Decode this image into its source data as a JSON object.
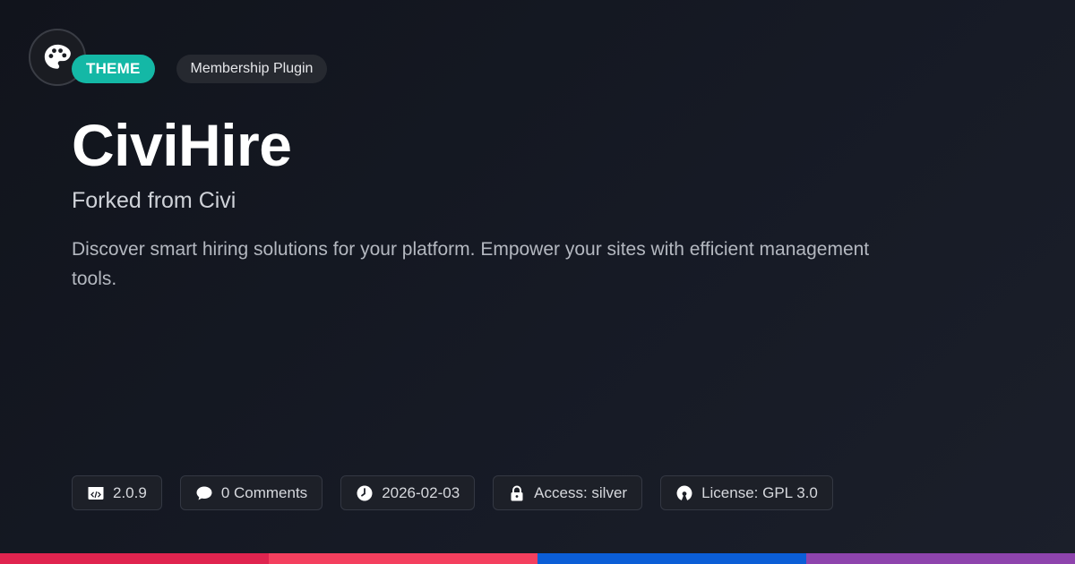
{
  "badges": {
    "type": "THEME",
    "category": "Membership Plugin"
  },
  "title": "CiviHire",
  "subtitle": "Forked from Civi",
  "description": "Discover smart hiring solutions for your platform. Empower your sites with efficient management tools.",
  "meta": {
    "version": "2.0.9",
    "comments": "0 Comments",
    "date": "2026-02-03",
    "access": "Access: silver",
    "license": "License: GPL 3.0"
  },
  "icons": {
    "logo": "palette-icon",
    "version": "code-icon",
    "comments": "comment-icon",
    "date": "clock-icon",
    "access": "lock-icon",
    "license": "open-source-icon"
  },
  "colors": {
    "theme_badge": "#14b8a6",
    "stripe_1": "#e0244f",
    "stripe_2": "#f43f5e",
    "stripe_3": "#0b5ed7",
    "stripe_4": "#8e44ad"
  }
}
